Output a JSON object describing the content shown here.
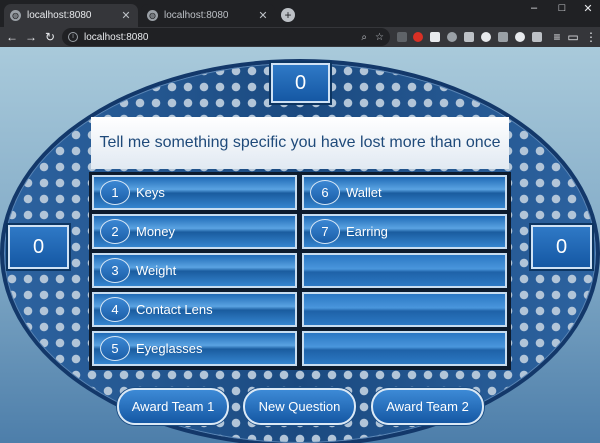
{
  "browser": {
    "tabs": [
      {
        "title": "localhost:8080",
        "active": true
      },
      {
        "title": "localhost:8080",
        "active": false
      }
    ],
    "new_tab_symbol": "+",
    "url": "localhost:8080",
    "window_controls": {
      "minimize": "–",
      "maximize": "□",
      "close": "✕"
    }
  },
  "game": {
    "question": "Tell me something specific you have lost more than once",
    "scores": {
      "top": "0",
      "left": "0",
      "right": "0"
    },
    "answers": [
      {
        "number": "1",
        "text": "Keys",
        "revealed": true
      },
      {
        "number": "2",
        "text": "Money",
        "revealed": true
      },
      {
        "number": "3",
        "text": "Weight",
        "revealed": true
      },
      {
        "number": "4",
        "text": "Contact Lens",
        "revealed": true
      },
      {
        "number": "5",
        "text": "Eyeglasses",
        "revealed": true
      },
      {
        "number": "6",
        "text": "Wallet",
        "revealed": true
      },
      {
        "number": "7",
        "text": "Earring",
        "revealed": true
      },
      {
        "number": "",
        "text": "",
        "revealed": false
      },
      {
        "number": "",
        "text": "",
        "revealed": false
      },
      {
        "number": "",
        "text": "",
        "revealed": false
      }
    ],
    "buttons": {
      "award_team_1": "Award Team 1",
      "new_question": "New Question",
      "award_team_2": "Award Team 2"
    }
  }
}
